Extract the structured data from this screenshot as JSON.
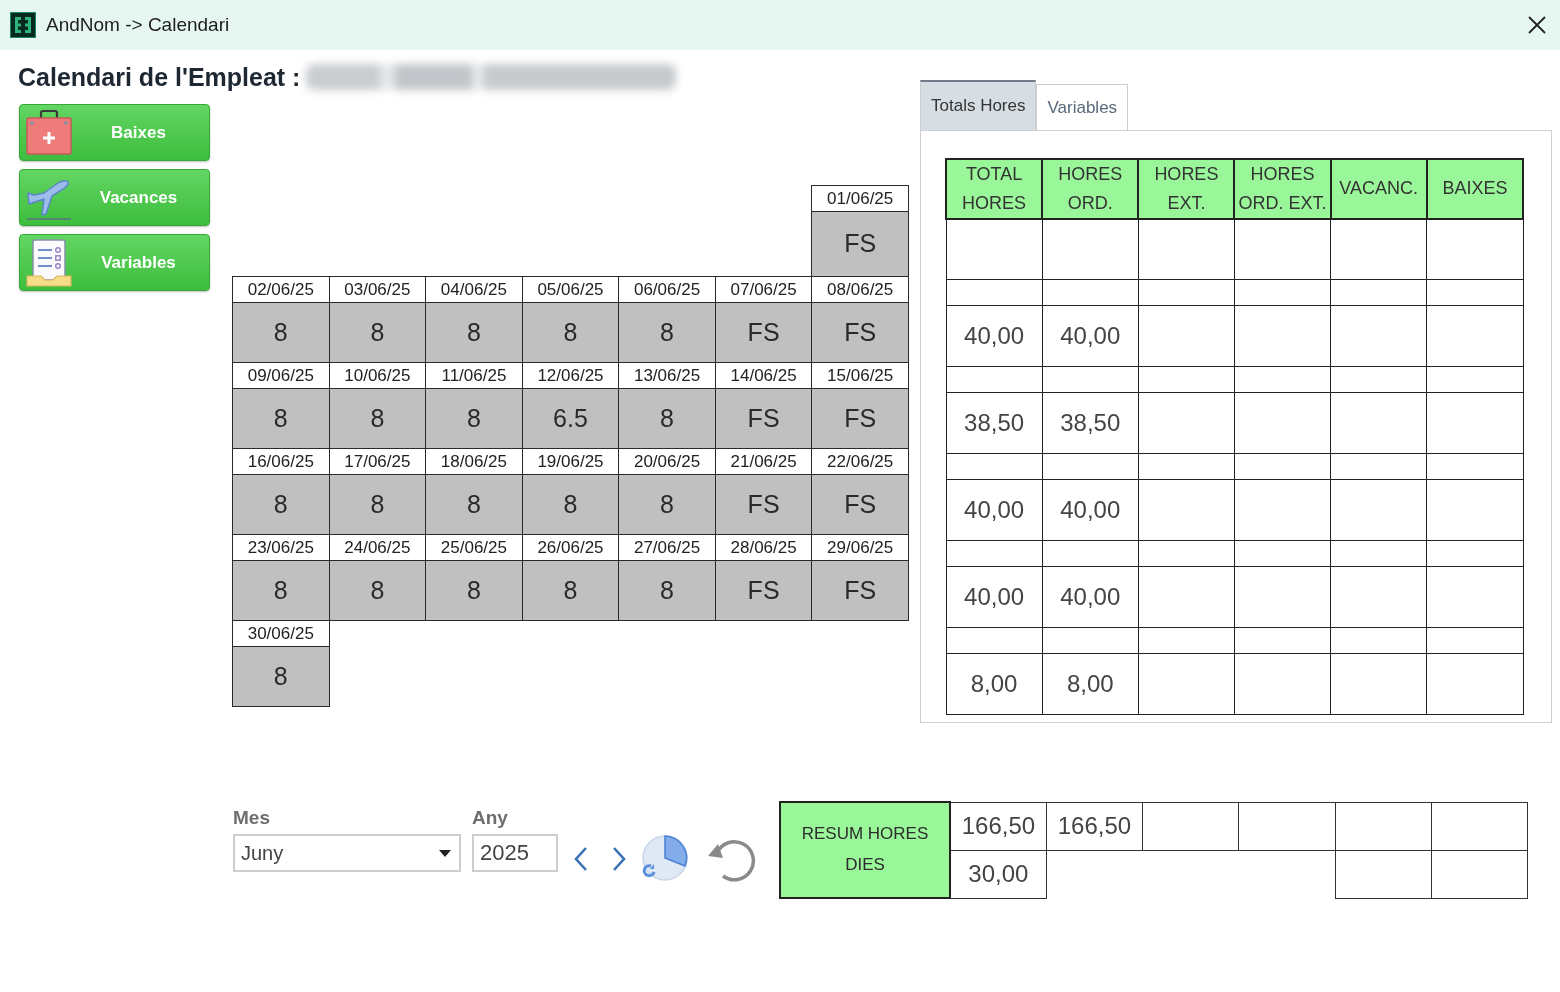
{
  "window": {
    "title": "AndNom -> Calendari"
  },
  "heading": "Calendari de l'Empleat :",
  "side_buttons": [
    {
      "label": "Baixes"
    },
    {
      "label": "Vacances"
    },
    {
      "label": "Variables"
    }
  ],
  "calendar": {
    "weeks": [
      {
        "kind": "start",
        "days": [
          {
            "date": "01/06/25",
            "hours": "FS"
          }
        ]
      },
      {
        "kind": "full",
        "days": [
          {
            "date": "02/06/25",
            "hours": "8"
          },
          {
            "date": "03/06/25",
            "hours": "8"
          },
          {
            "date": "04/06/25",
            "hours": "8"
          },
          {
            "date": "05/06/25",
            "hours": "8"
          },
          {
            "date": "06/06/25",
            "hours": "8"
          },
          {
            "date": "07/06/25",
            "hours": "FS"
          },
          {
            "date": "08/06/25",
            "hours": "FS"
          }
        ]
      },
      {
        "kind": "full",
        "days": [
          {
            "date": "09/06/25",
            "hours": "8"
          },
          {
            "date": "10/06/25",
            "hours": "8"
          },
          {
            "date": "11/06/25",
            "hours": "8"
          },
          {
            "date": "12/06/25",
            "hours": "6.5"
          },
          {
            "date": "13/06/25",
            "hours": "8"
          },
          {
            "date": "14/06/25",
            "hours": "FS"
          },
          {
            "date": "15/06/25",
            "hours": "FS"
          }
        ]
      },
      {
        "kind": "full",
        "days": [
          {
            "date": "16/06/25",
            "hours": "8"
          },
          {
            "date": "17/06/25",
            "hours": "8"
          },
          {
            "date": "18/06/25",
            "hours": "8"
          },
          {
            "date": "19/06/25",
            "hours": "8"
          },
          {
            "date": "20/06/25",
            "hours": "8"
          },
          {
            "date": "21/06/25",
            "hours": "FS"
          },
          {
            "date": "22/06/25",
            "hours": "FS"
          }
        ]
      },
      {
        "kind": "full",
        "days": [
          {
            "date": "23/06/25",
            "hours": "8"
          },
          {
            "date": "24/06/25",
            "hours": "8"
          },
          {
            "date": "25/06/25",
            "hours": "8"
          },
          {
            "date": "26/06/25",
            "hours": "8"
          },
          {
            "date": "27/06/25",
            "hours": "8"
          },
          {
            "date": "28/06/25",
            "hours": "FS"
          },
          {
            "date": "29/06/25",
            "hours": "FS"
          }
        ]
      },
      {
        "kind": "end",
        "days": [
          {
            "date": "30/06/25",
            "hours": "8"
          }
        ]
      }
    ]
  },
  "tabs": [
    {
      "label": "Totals Hores",
      "selected": true
    },
    {
      "label": "Variables",
      "selected": false
    }
  ],
  "totals_table": {
    "columns": [
      "TOTAL\nHORES",
      "HORES\nORD.",
      "HORES\nEXT.",
      "HORES\nORD. EXT.",
      "VACANC.",
      "BAIXES"
    ],
    "rows": [
      {
        "cells": [
          null,
          null,
          null,
          null,
          null,
          null
        ]
      },
      {
        "cells": [
          "40,00",
          "40,00",
          null,
          null,
          null,
          null
        ]
      },
      {
        "cells": [
          "38,50",
          "38,50",
          null,
          null,
          null,
          null
        ]
      },
      {
        "cells": [
          "40,00",
          "40,00",
          null,
          null,
          null,
          null
        ]
      },
      {
        "cells": [
          "40,00",
          "40,00",
          null,
          null,
          null,
          null
        ]
      },
      {
        "cells": [
          "8,00",
          "8,00",
          null,
          null,
          null,
          null
        ]
      }
    ]
  },
  "month": {
    "label": "Mes",
    "value": "Juny"
  },
  "year": {
    "label": "Any",
    "value": "2025"
  },
  "summary": {
    "label": "RESUM HORES\nDIES",
    "hours": [
      "166,50",
      "166,50"
    ],
    "days": [
      "30,00"
    ]
  }
}
